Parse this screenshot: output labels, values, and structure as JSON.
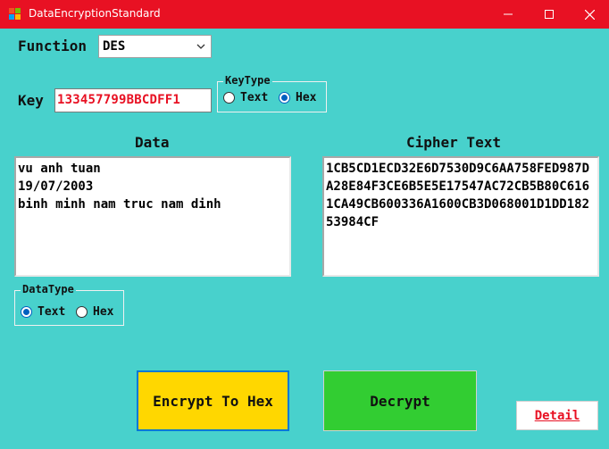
{
  "window": {
    "title": "DataEncryptionStandard"
  },
  "function": {
    "label": "Function",
    "selected": "DES"
  },
  "key": {
    "label": "Key",
    "value": "133457799BBCDFF1"
  },
  "key_type": {
    "title": "KeyType",
    "options": [
      "Text",
      "Hex"
    ],
    "selected": "Hex"
  },
  "data": {
    "label": "Data",
    "lines": [
      "vu anh tuan",
      "19/07/2003",
      "binh minh nam truc nam dinh"
    ]
  },
  "cipher": {
    "label": "Cipher Text",
    "value": "1CB5CD1ECD32E6D7530D9C6AA758FED987DA28E84F3CE6B5E5E17547AC72CB5B80C6161CA49CB600336A1600CB3D068001D1DD18253984CF"
  },
  "data_type": {
    "title": "DataType",
    "options": [
      "Text",
      "Hex"
    ],
    "selected": "Text"
  },
  "buttons": {
    "encrypt": "Encrypt To Hex",
    "decrypt": "Decrypt",
    "detail": "Detail"
  },
  "colors": {
    "titlebar": "#e81123",
    "background": "#48d1cc",
    "encrypt": "#ffd700",
    "decrypt": "#32cd32",
    "key_text": "#e81123"
  }
}
